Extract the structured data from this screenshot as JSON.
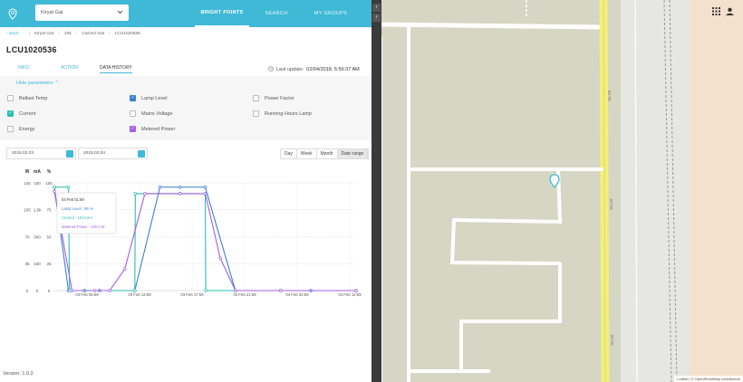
{
  "header": {
    "location_select": "Kiryat Gat",
    "nav_tabs": [
      "BRIGHT POINTS",
      "SEARCH",
      "MY GROUPS"
    ],
    "active_tab": "BRIGHT POINTS"
  },
  "breadcrumb": {
    "back": "Back",
    "items": [
      "Kiryat Gat",
      "105",
      "Carmel Gat",
      "LCU1020536"
    ]
  },
  "device": {
    "title": "LCU1020536",
    "tabs": [
      "INFO",
      "ACTION",
      "DATA HISTORY"
    ],
    "active_tab": "DATA HISTORY",
    "last_update_label": "Last update:",
    "last_update_value": "02/04/2018, 5:59:37 AM"
  },
  "parameters": {
    "toggle_label": "Hide parameters",
    "items": [
      {
        "label": "Ballast Temp",
        "checked": false,
        "color": "#cccccc"
      },
      {
        "label": "Lamp Level",
        "checked": true,
        "color": "#3b7fd4"
      },
      {
        "label": "Power Factor",
        "checked": false,
        "color": "#cccccc"
      },
      {
        "label": "Current",
        "checked": true,
        "color": "#2bbfb3"
      },
      {
        "label": "Mains Voltage",
        "checked": false,
        "color": "#cccccc"
      },
      {
        "label": "Running Hours Lamp",
        "checked": false,
        "color": "#cccccc"
      },
      {
        "label": "Energy",
        "checked": false,
        "color": "#cccccc"
      },
      {
        "label": "Metered Power",
        "checked": true,
        "color": "#a35fe0"
      }
    ]
  },
  "date_range": {
    "from": "2018.02.03",
    "to": "2018.02.04",
    "buttons": [
      "Day",
      "Week",
      "Month",
      "Date range"
    ],
    "active": "Date range"
  },
  "chart_data": {
    "type": "line",
    "axis_units": [
      "W",
      "mA",
      "%"
    ],
    "y_ticks": [
      {
        "w": "140",
        "ma": "150",
        "pct": "100"
      },
      {
        "w": "105",
        "ma": "1.5k",
        "pct": "75"
      },
      {
        "w": "70",
        "ma": "300",
        "pct": "50"
      },
      {
        "w": "35",
        "ma": "150",
        "pct": "25"
      },
      {
        "w": "0",
        "ma": "0",
        "pct": "0"
      }
    ],
    "x_ticks": [
      "03 Feb 05:59",
      "03 Feb 12:59",
      "03 Feb 17:59",
      "03 Feb 21:59",
      "04 Feb 02:59",
      "04 Feb 12:59"
    ],
    "tooltip": {
      "title": "03 Feb 01:59",
      "lamp_level": "Lamp Level : 96 %",
      "current": "Current : 1014 mA",
      "metered_power": "Metered Power : 129.2 W"
    },
    "series": [
      {
        "name": "Lamp Level",
        "color": "#3b7fd4",
        "unit": "%",
        "x": [
          0,
          0.28,
          0.6,
          0.9,
          1.6,
          2.1,
          2.5,
          3.0,
          3.6,
          4.5,
          5.1,
          6.0
        ],
        "y": [
          96,
          0,
          0,
          0,
          0,
          96,
          96,
          96,
          0,
          0,
          0,
          0
        ]
      },
      {
        "name": "Current",
        "color": "#2bbfb3",
        "unit": "mA",
        "x": [
          0,
          0.28,
          0.3,
          0.6,
          1.6,
          1.61,
          2.5,
          3.0,
          3.01,
          4.5,
          6.0
        ],
        "y": [
          96,
          96,
          0,
          0,
          0,
          90,
          90,
          90,
          0,
          0,
          0
        ]
      },
      {
        "name": "Metered Power",
        "color": "#a35fe0",
        "unit": "W",
        "x": [
          0,
          0.35,
          0.8,
          1.1,
          1.4,
          1.8,
          2.5,
          3.0,
          3.3,
          3.6,
          4.5,
          6.0
        ],
        "y": [
          92,
          0,
          0,
          0,
          20,
          90,
          90,
          90,
          30,
          0,
          0,
          0
        ]
      }
    ]
  },
  "footer": {
    "version": "Version: 1.0.2"
  },
  "map": {
    "street_labels": [
      "BYTE",
      "BYTE",
      "BYTE"
    ],
    "attribution": "Leaflet | © OpenStreetMap contributors"
  }
}
